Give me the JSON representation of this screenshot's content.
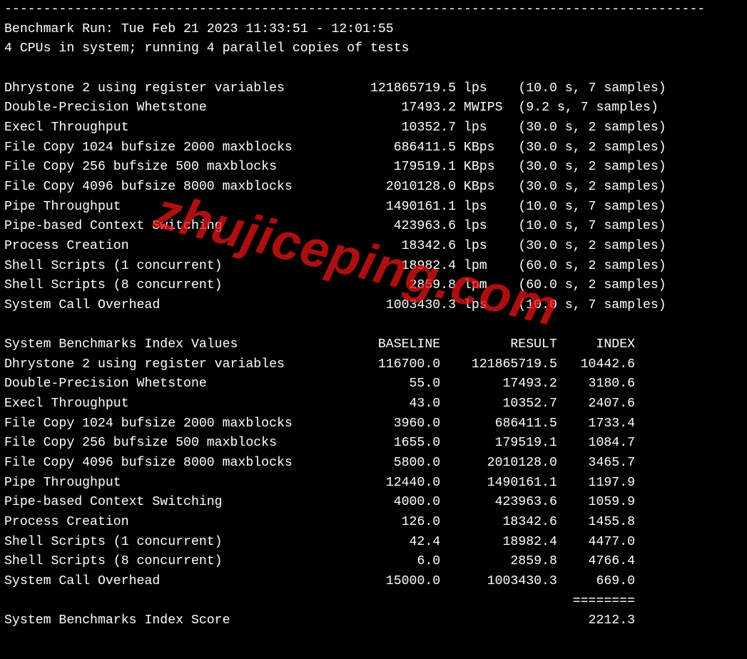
{
  "header": {
    "dashes": "------------------------------------------------------------------------------------------",
    "run_line": "Benchmark Run: Tue Feb 21 2023 11:33:51 - 12:01:55",
    "cpu_line": "4 CPUs in system; running 4 parallel copies of tests"
  },
  "results": [
    {
      "name": "Dhrystone 2 using register variables",
      "value": "121865719.5",
      "unit": "lps",
      "meta": "(10.0 s, 7 samples)"
    },
    {
      "name": "Double-Precision Whetstone",
      "value": "17493.2",
      "unit": "MWIPS",
      "meta": "(9.2 s, 7 samples)"
    },
    {
      "name": "Execl Throughput",
      "value": "10352.7",
      "unit": "lps",
      "meta": "(30.0 s, 2 samples)"
    },
    {
      "name": "File Copy 1024 bufsize 2000 maxblocks",
      "value": "686411.5",
      "unit": "KBps",
      "meta": "(30.0 s, 2 samples)"
    },
    {
      "name": "File Copy 256 bufsize 500 maxblocks",
      "value": "179519.1",
      "unit": "KBps",
      "meta": "(30.0 s, 2 samples)"
    },
    {
      "name": "File Copy 4096 bufsize 8000 maxblocks",
      "value": "2010128.0",
      "unit": "KBps",
      "meta": "(30.0 s, 2 samples)"
    },
    {
      "name": "Pipe Throughput",
      "value": "1490161.1",
      "unit": "lps",
      "meta": "(10.0 s, 7 samples)"
    },
    {
      "name": "Pipe-based Context Switching",
      "value": "423963.6",
      "unit": "lps",
      "meta": "(10.0 s, 7 samples)"
    },
    {
      "name": "Process Creation",
      "value": "18342.6",
      "unit": "lps",
      "meta": "(30.0 s, 2 samples)"
    },
    {
      "name": "Shell Scripts (1 concurrent)",
      "value": "18982.4",
      "unit": "lpm",
      "meta": "(60.0 s, 2 samples)"
    },
    {
      "name": "Shell Scripts (8 concurrent)",
      "value": "2859.8",
      "unit": "lpm",
      "meta": "(60.0 s, 2 samples)"
    },
    {
      "name": "System Call Overhead",
      "value": "1003430.3",
      "unit": "lps",
      "meta": "(10.0 s, 7 samples)"
    }
  ],
  "index_header": {
    "c1": "System Benchmarks Index Values",
    "c2": "BASELINE",
    "c3": "RESULT",
    "c4": "INDEX"
  },
  "index": [
    {
      "name": "Dhrystone 2 using register variables",
      "baseline": "116700.0",
      "result": "121865719.5",
      "index": "10442.6"
    },
    {
      "name": "Double-Precision Whetstone",
      "baseline": "55.0",
      "result": "17493.2",
      "index": "3180.6"
    },
    {
      "name": "Execl Throughput",
      "baseline": "43.0",
      "result": "10352.7",
      "index": "2407.6"
    },
    {
      "name": "File Copy 1024 bufsize 2000 maxblocks",
      "baseline": "3960.0",
      "result": "686411.5",
      "index": "1733.4"
    },
    {
      "name": "File Copy 256 bufsize 500 maxblocks",
      "baseline": "1655.0",
      "result": "179519.1",
      "index": "1084.7"
    },
    {
      "name": "File Copy 4096 bufsize 8000 maxblocks",
      "baseline": "5800.0",
      "result": "2010128.0",
      "index": "3465.7"
    },
    {
      "name": "Pipe Throughput",
      "baseline": "12440.0",
      "result": "1490161.1",
      "index": "1197.9"
    },
    {
      "name": "Pipe-based Context Switching",
      "baseline": "4000.0",
      "result": "423963.6",
      "index": "1059.9"
    },
    {
      "name": "Process Creation",
      "baseline": "126.0",
      "result": "18342.6",
      "index": "1455.8"
    },
    {
      "name": "Shell Scripts (1 concurrent)",
      "baseline": "42.4",
      "result": "18982.4",
      "index": "4477.0"
    },
    {
      "name": "Shell Scripts (8 concurrent)",
      "baseline": "6.0",
      "result": "2859.8",
      "index": "4766.4"
    },
    {
      "name": "System Call Overhead",
      "baseline": "15000.0",
      "result": "1003430.3",
      "index": "669.0"
    }
  ],
  "rule": "========",
  "score": {
    "label": "System Benchmarks Index Score",
    "value": "2212.3"
  },
  "watermark": "zhujiceping.com"
}
